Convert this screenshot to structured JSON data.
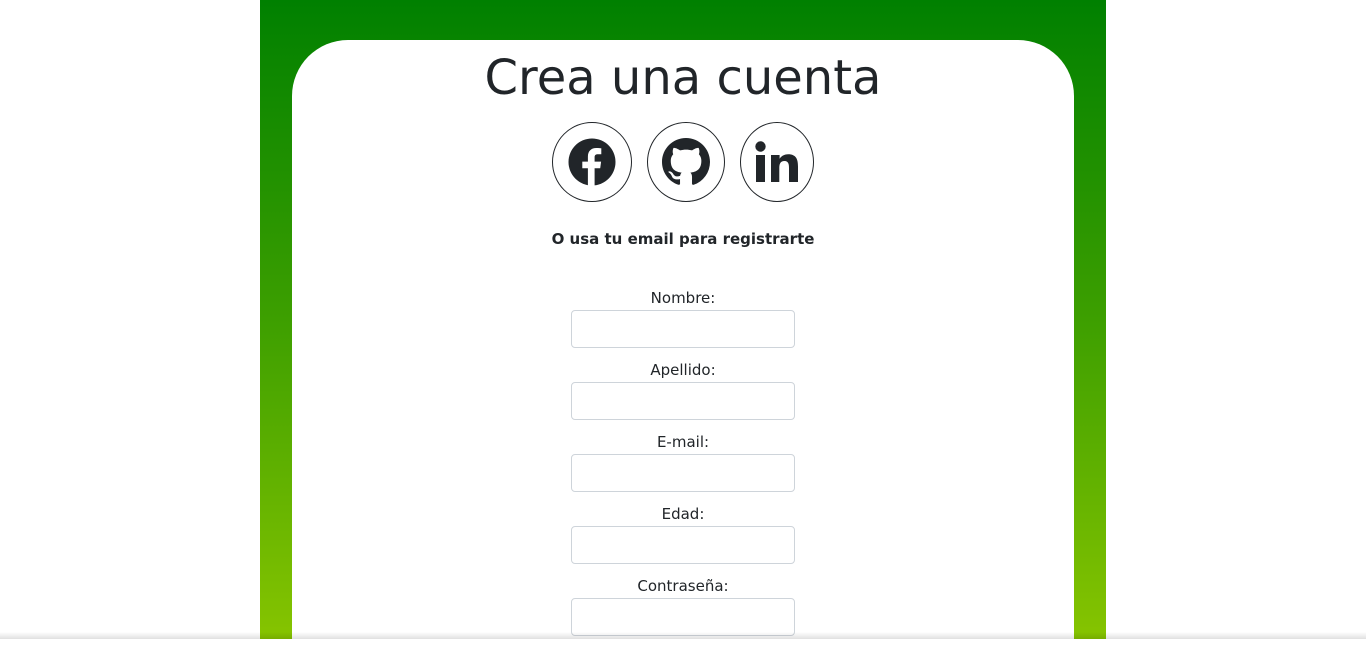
{
  "form": {
    "title": "Crea una cuenta",
    "subtitle": "O usa tu email para registrarte",
    "social": [
      {
        "name": "facebook",
        "icon": "facebook-icon"
      },
      {
        "name": "github",
        "icon": "github-icon"
      },
      {
        "name": "linkedin",
        "icon": "linkedin-icon"
      }
    ],
    "fields": [
      {
        "label": "Nombre:",
        "value": "",
        "placeholder": ""
      },
      {
        "label": "Apellido:",
        "value": "",
        "placeholder": ""
      },
      {
        "label": "E-mail:",
        "value": "",
        "placeholder": ""
      },
      {
        "label": "Edad:",
        "value": "",
        "placeholder": ""
      },
      {
        "label": "Contraseña:",
        "value": "",
        "placeholder": ""
      }
    ]
  },
  "colors": {
    "gradient_top": "#008000",
    "gradient_bottom": "#86c400",
    "text": "#212529",
    "input_border": "#ced4da"
  }
}
